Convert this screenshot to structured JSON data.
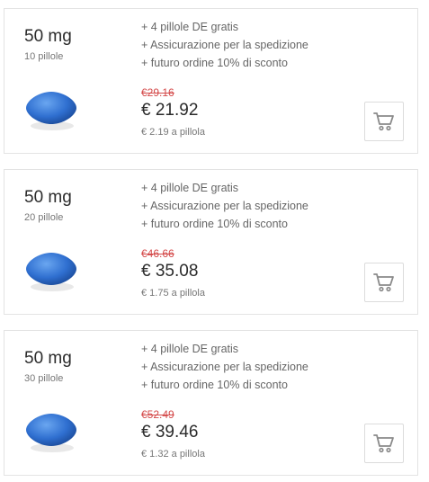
{
  "offers": [
    {
      "dose": "50 mg",
      "count": "10 pillole",
      "features": [
        "+ 4 pillole DE gratis",
        "+ Assicurazione per la spedizione",
        "+ futuro ordine 10% di sconto"
      ],
      "old_price": "€29.16",
      "price": "€ 21.92",
      "per_pill": "€ 2.19 a pillola"
    },
    {
      "dose": "50 mg",
      "count": "20 pillole",
      "features": [
        "+ 4 pillole DE gratis",
        "+ Assicurazione per la spedizione",
        "+ futuro ordine 10% di sconto"
      ],
      "old_price": "€46.66",
      "price": "€ 35.08",
      "per_pill": "€ 1.75 a pillola"
    },
    {
      "dose": "50 mg",
      "count": "30 pillole",
      "features": [
        "+ 4 pillole DE gratis",
        "+ Assicurazione per la spedizione",
        "+ futuro ordine 10% di sconto"
      ],
      "old_price": "€52.49",
      "price": "€ 39.46",
      "per_pill": "€ 1.32 a pillola"
    }
  ],
  "icons": {
    "product": "blue-pill-icon",
    "cart": "shopping-cart-icon"
  },
  "colors": {
    "old_price": "#d44a4a",
    "pill": "#2f6fd0",
    "cart_icon": "#8a8a8a"
  }
}
